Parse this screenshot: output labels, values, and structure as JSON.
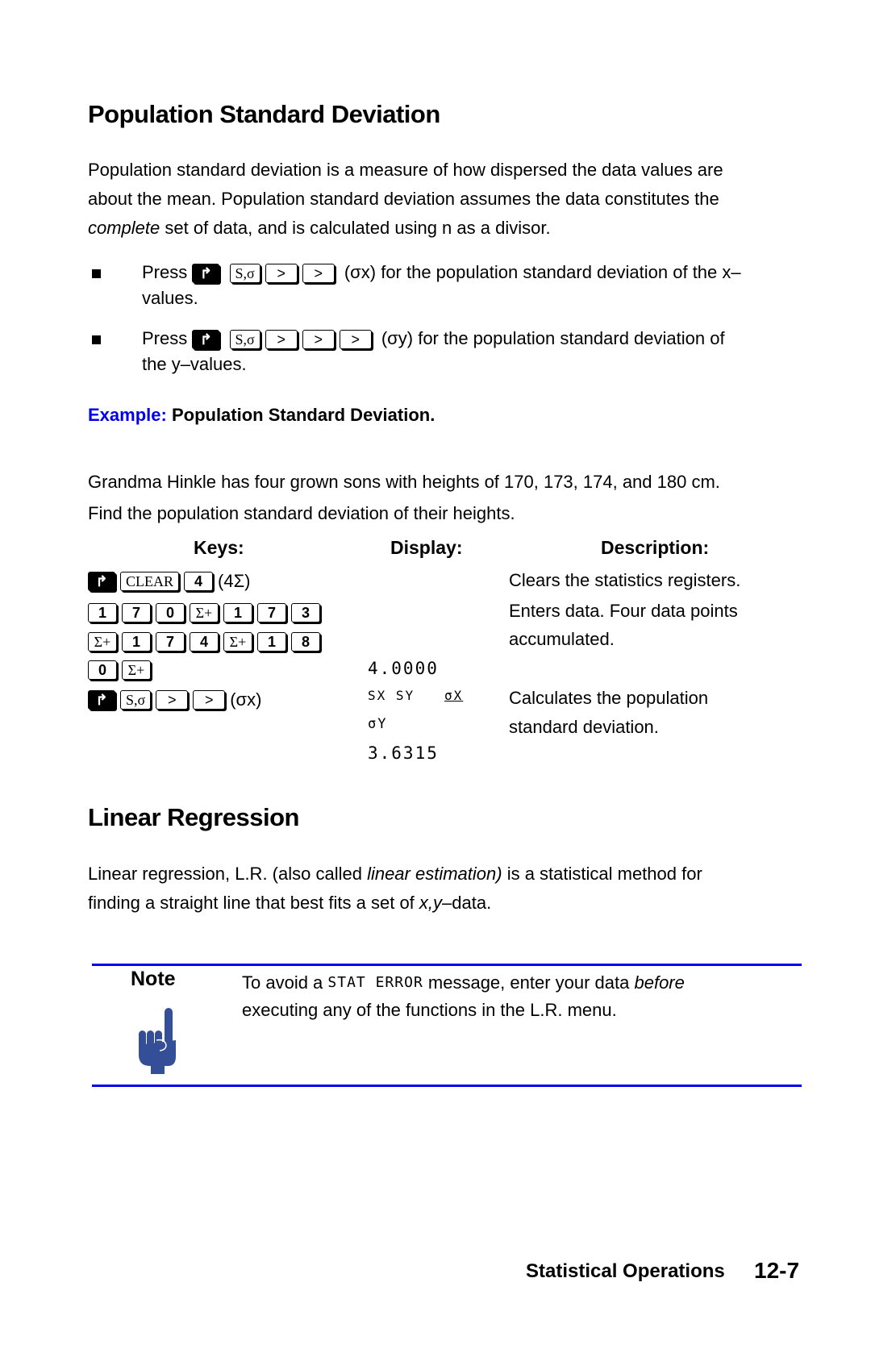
{
  "section1": {
    "title": "Population Standard Deviation",
    "intro_line1": "Population standard deviation is a measure of how dispersed the data values are",
    "intro_line2": "about the mean. Population standard deviation assumes the data constitutes the",
    "intro_line3_italic": "complete",
    "intro_line3_rest": " set of data, and is calculated using n as a divisor.",
    "bullets": [
      {
        "press": "Press",
        "keys": [
          "shift-right",
          "S,σ",
          ">",
          ">"
        ],
        "annotation": "(σx)",
        "text_line1": "for the population standard deviation of the x–",
        "text_line2": "values."
      },
      {
        "press": "Press",
        "keys": [
          "shift-right",
          "S,σ",
          ">",
          ">",
          ">"
        ],
        "annotation": "(σy)",
        "text_line1": "for the population standard deviation of",
        "text_line2": "the y–values."
      }
    ],
    "example_label": "Example:",
    "example_title": "Population Standard Deviation.",
    "problem_line1": "Grandma Hinkle has four grown sons with heights of 170, 173, 174, and 180 cm.",
    "problem_line2": "Find the population standard deviation of their heights.",
    "table": {
      "headers": {
        "keys": "Keys:",
        "display": "Display:",
        "description": "Description:"
      },
      "rows": [
        {
          "keys": [
            "shift-right",
            "CLEAR",
            "4"
          ],
          "annotation": "(4Σ)",
          "display": "",
          "description": "Clears the statistics registers."
        },
        {
          "keys": [
            "1",
            "7",
            "0",
            "Σ+",
            "1",
            "7",
            "3"
          ],
          "display": "",
          "description": "Enters data. Four data points"
        },
        {
          "keys": [
            "Σ+",
            "1",
            "7",
            "4",
            "Σ+",
            "1",
            "8"
          ],
          "display": "",
          "description": "accumulated."
        },
        {
          "keys": [
            "0",
            "Σ+"
          ],
          "display": "4.0000",
          "description": ""
        },
        {
          "keys": [
            "shift-right",
            "S,σ",
            ">",
            ">"
          ],
          "annotation": "(σx)",
          "display_menu": [
            "SX",
            "SY",
            "σX"
          ],
          "description": "Calculates the population"
        },
        {
          "keys": [],
          "display": "σY",
          "description": "standard deviation."
        },
        {
          "keys": [],
          "display": "3.6315",
          "description": ""
        }
      ]
    }
  },
  "section2": {
    "title": "Linear Regression",
    "line1_a": "Linear regression, L.R. (also called ",
    "line1_italic": "linear estimation)",
    "line1_b": " is a statistical method for",
    "line2_a": "finding a straight line that best fits a set of ",
    "line2_italic": "x,y",
    "line2_b": "–data."
  },
  "note": {
    "label": "Note",
    "text_a": "To avoid a ",
    "lcd": "STAT ERROR",
    "text_b": " message, enter your data ",
    "italic": "before",
    "line2": "executing any of the functions in the L.R. menu.",
    "icon": "pointing-hand-icon"
  },
  "footer": {
    "chapter": "Statistical Operations",
    "page": "12-7"
  },
  "colors": {
    "accent_blue": "#0000ee",
    "note_icon": "#344f98"
  }
}
